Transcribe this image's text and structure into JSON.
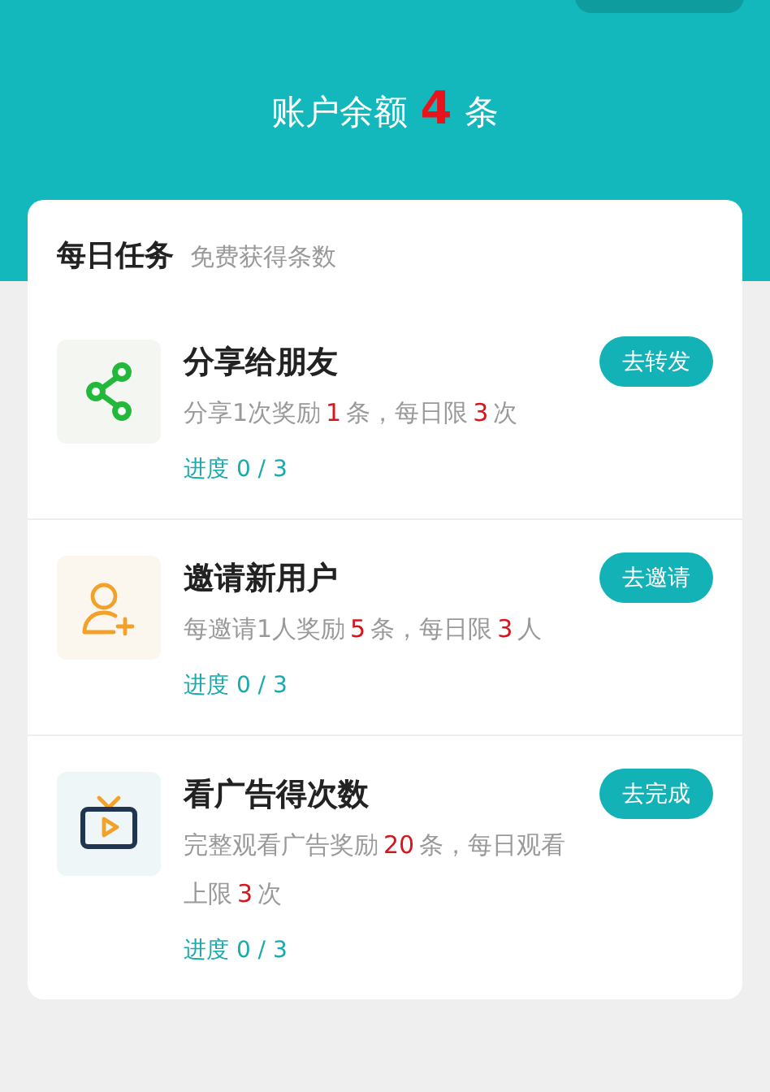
{
  "balance": {
    "label": "账户余额",
    "amount": "4",
    "unit": "条"
  },
  "daily_tasks": {
    "title": "每日任务",
    "subtitle": "免费获得条数",
    "tasks": [
      {
        "kind": "share",
        "title": "分享给朋友",
        "description": [
          {
            "text": "分享1次奖励",
            "highlight": false
          },
          {
            "text": "1",
            "highlight": true
          },
          {
            "text": "条，每日限",
            "highlight": false
          },
          {
            "text": "3",
            "highlight": true
          },
          {
            "text": "次",
            "highlight": false
          }
        ],
        "progress": "进度 0 / 3",
        "button": "去转发"
      },
      {
        "kind": "invite",
        "title": "邀请新用户",
        "description": [
          {
            "text": "每邀请1人奖励",
            "highlight": false
          },
          {
            "text": "5",
            "highlight": true
          },
          {
            "text": "条，每日限",
            "highlight": false
          },
          {
            "text": "3",
            "highlight": true
          },
          {
            "text": "人",
            "highlight": false
          }
        ],
        "progress": "进度 0 / 3",
        "button": "去邀请"
      },
      {
        "kind": "tv",
        "title": "看广告得次数",
        "description": [
          {
            "text": "完整观看广告奖励",
            "highlight": false
          },
          {
            "text": "20",
            "highlight": true
          },
          {
            "text": "条，每日观看上限",
            "highlight": false
          },
          {
            "text": "3",
            "highlight": true
          },
          {
            "text": "次",
            "highlight": false
          }
        ],
        "progress": "进度 0 / 3",
        "button": "去完成"
      }
    ]
  }
}
